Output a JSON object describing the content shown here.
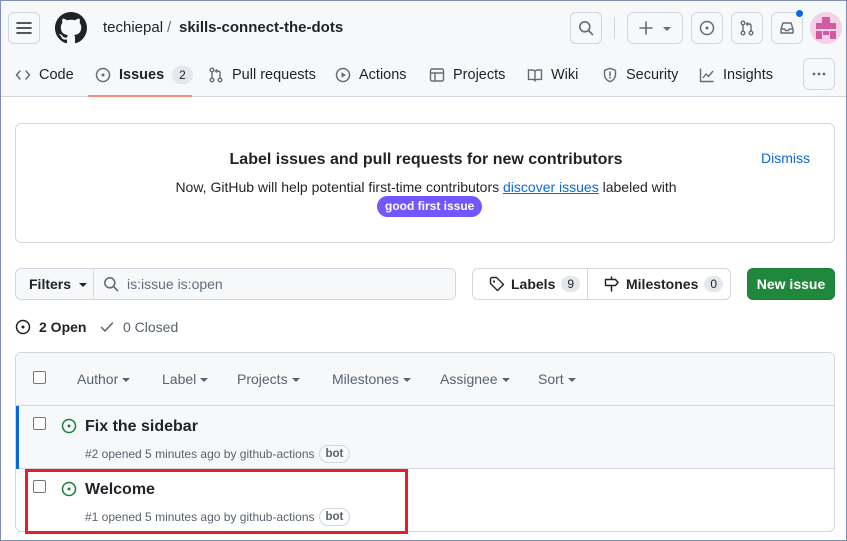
{
  "header": {
    "owner": "techiepal",
    "separator": "/",
    "repo": "skills-connect-the-dots"
  },
  "tabs": [
    {
      "label": "Code",
      "icon": "code-icon"
    },
    {
      "label": "Issues",
      "icon": "issue-opened-icon",
      "count": "2",
      "selected": true
    },
    {
      "label": "Pull requests",
      "icon": "git-pull-request-icon"
    },
    {
      "label": "Actions",
      "icon": "play-icon"
    },
    {
      "label": "Projects",
      "icon": "table-icon"
    },
    {
      "label": "Wiki",
      "icon": "book-icon"
    },
    {
      "label": "Security",
      "icon": "shield-icon"
    },
    {
      "label": "Insights",
      "icon": "graph-icon"
    }
  ],
  "banner": {
    "title": "Label issues and pull requests for new contributors",
    "text_before": "Now, GitHub will help potential first-time contributors",
    "link": "discover issues",
    "text_after": "labeled with",
    "label": "good first issue",
    "dismiss": "Dismiss"
  },
  "filters": {
    "filters_label": "Filters",
    "search_value": "is:issue is:open",
    "labels_label": "Labels",
    "labels_count": "9",
    "milestones_label": "Milestones",
    "milestones_count": "0",
    "new_issue": "New issue"
  },
  "states": {
    "open": "2 Open",
    "closed": "0 Closed"
  },
  "columns": [
    "Author",
    "Label",
    "Projects",
    "Milestones",
    "Assignee",
    "Sort"
  ],
  "issues": [
    {
      "title": "Fix the sidebar",
      "meta": "#2 opened 5 minutes ago by github-actions",
      "badge": "bot"
    },
    {
      "title": "Welcome",
      "meta": "#1 opened 5 minutes ago by github-actions",
      "badge": "bot"
    }
  ],
  "colors": {
    "accent": "#0969da",
    "primary_button": "#1f883d",
    "good_first_issue": "#7057ff",
    "open_icon": "#1a7f37",
    "highlight": "#e0202a",
    "tab_underline": "#fd8c73"
  }
}
